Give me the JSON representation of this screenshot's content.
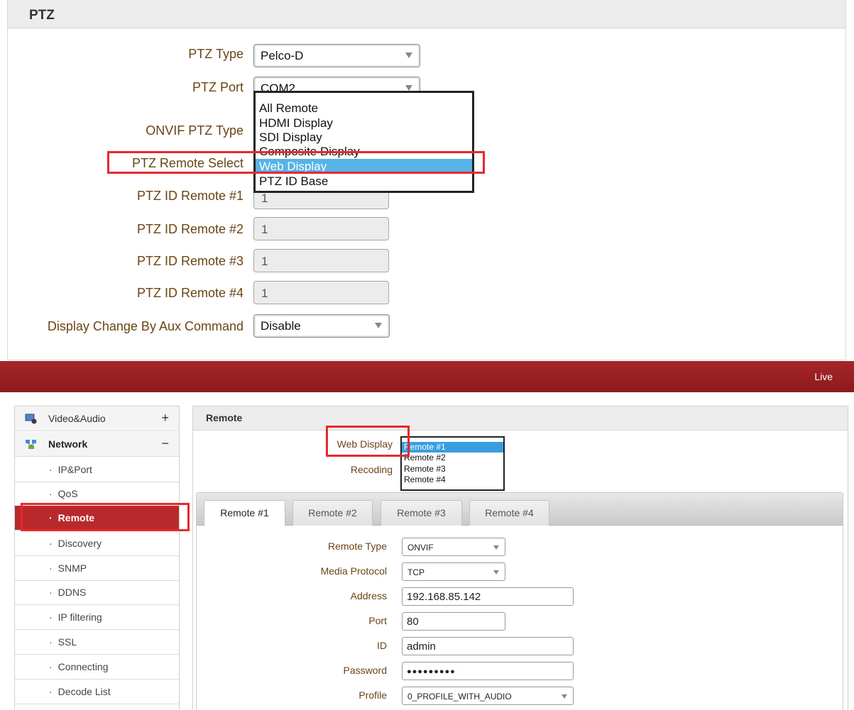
{
  "ptz": {
    "title": "PTZ",
    "fields": {
      "ptz_type_label": "PTZ Type",
      "ptz_type_value": "Pelco-D",
      "ptz_port_label": "PTZ Port",
      "ptz_port_value": "COM2",
      "onvif_label": "ONVIF PTZ Type",
      "remote_select_label": "PTZ Remote Select",
      "remote1_label": "PTZ ID Remote #1",
      "remote1_value": "1",
      "remote2_label": "PTZ ID Remote #2",
      "remote2_value": "1",
      "remote3_label": "PTZ ID Remote #3",
      "remote3_value": "1",
      "remote4_label": "PTZ ID Remote #4",
      "remote4_value": "1",
      "aux_label": "Display Change By Aux Command",
      "aux_value": "Disable"
    },
    "dropdown": {
      "options": [
        "All Remote",
        "HDMI Display",
        "SDI Display",
        "Composite Display",
        "Web Display",
        "PTZ ID Base"
      ],
      "selected": "Web Display"
    }
  },
  "topbar": {
    "live_label": "Live",
    "color": "#9b2226"
  },
  "sidebar": {
    "video_audio": {
      "label": "Video&Audio",
      "sign": "+"
    },
    "network": {
      "label": "Network",
      "sign": "−"
    },
    "items": [
      {
        "label": "IP&Port"
      },
      {
        "label": "QoS"
      },
      {
        "label": "Remote"
      },
      {
        "label": "Discovery"
      },
      {
        "label": "SNMP"
      },
      {
        "label": "DDNS"
      },
      {
        "label": "IP filtering"
      },
      {
        "label": "SSL"
      },
      {
        "label": "Connecting"
      },
      {
        "label": "Decode List"
      }
    ],
    "active_item": "Remote"
  },
  "remote": {
    "title": "Remote",
    "web_display_label": "Web Display",
    "recoding_label": "Recoding",
    "web_display_dropdown": {
      "options": [
        "Remote #1",
        "Remote #2",
        "Remote #3",
        "Remote #4"
      ],
      "selected": "Remote #1"
    },
    "tabs": [
      {
        "label": "Remote #1"
      },
      {
        "label": "Remote #2"
      },
      {
        "label": "Remote #3"
      },
      {
        "label": "Remote #4"
      }
    ],
    "form": {
      "remote_type_label": "Remote Type",
      "remote_type_value": "ONVIF",
      "media_protocol_label": "Media Protocol",
      "media_protocol_value": "TCP",
      "address_label": "Address",
      "address_value": "192.168.85.142",
      "port_label": "Port",
      "port_value": "80",
      "id_label": "ID",
      "id_value": "admin",
      "password_label": "Password",
      "password_value": "●●●●●●●●●",
      "profile_label": "Profile",
      "profile_value": "0_PROFILE_WITH_AUDIO"
    }
  },
  "colors": {
    "highlight": "#e8282e",
    "selected_option": "#56b3e6",
    "active_sidebar": "#b82a2c",
    "label_text": "#6b4414"
  }
}
